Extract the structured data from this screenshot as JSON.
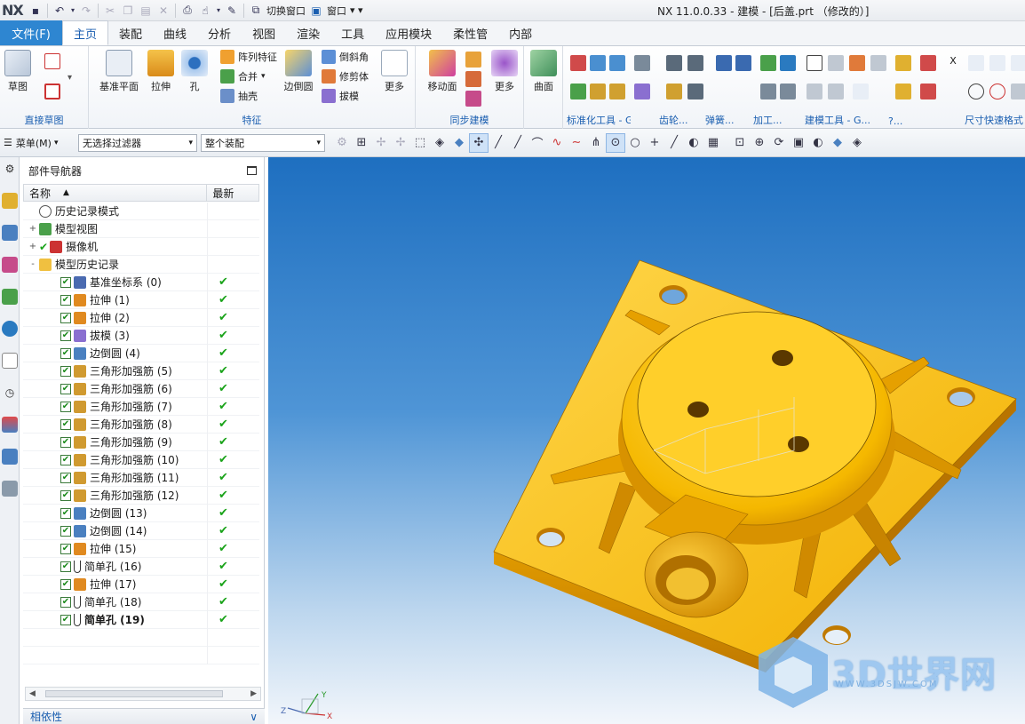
{
  "app": {
    "logo": "NX",
    "title": "NX 11.0.0.33 - 建模 - [后盖.prt （修改的）]"
  },
  "quick_access": {
    "switch_window": "切换窗口",
    "window": "窗口"
  },
  "tabs": [
    "文件(F)",
    "主页",
    "装配",
    "曲线",
    "分析",
    "视图",
    "渲染",
    "工具",
    "应用模块",
    "柔性管",
    "内部"
  ],
  "active_tab": "主页",
  "ribbon": {
    "direct_sketch": {
      "sketch": "草图",
      "label": "直接草图"
    },
    "feature": {
      "datum_plane": "基准平面",
      "extrude": "拉伸",
      "hole": "孔",
      "pattern": "阵列特征",
      "unite": "合并",
      "shell": "抽壳",
      "edge_blend": "边倒圆",
      "chamfer": "倒斜角",
      "trim_body": "修剪体",
      "draft": "拔模",
      "more": "更多",
      "label": "特征"
    },
    "sync": {
      "move_face": "移动面",
      "more": "更多",
      "label": "同步建模"
    },
    "surface": {
      "surface": "曲面"
    },
    "tools": {
      "std_tools": "标准化工具 - G...",
      "gear": "齿轮...",
      "spring": "弹簧...",
      "machining": "加工...",
      "modeling_tools": "建模工具 - G...",
      "more": "?...",
      "dim_quick": "尺寸快速格式"
    }
  },
  "cmdbar": {
    "menu": "菜单(M)",
    "filter": "无选择过滤器",
    "scope": "整个装配"
  },
  "navigator": {
    "title": "部件导航器",
    "col_name": "名称",
    "col_latest": "最新",
    "top_nodes": [
      {
        "label": "历史记录模式",
        "exp": ""
      },
      {
        "label": "模型视图",
        "exp": "+"
      },
      {
        "label": "摄像机",
        "exp": "+"
      },
      {
        "label": "模型历史记录",
        "exp": "-"
      }
    ],
    "features": [
      {
        "label": "基准坐标系 (0)",
        "icon": "csys"
      },
      {
        "label": "拉伸 (1)",
        "icon": "extrude"
      },
      {
        "label": "拉伸 (2)",
        "icon": "extrude"
      },
      {
        "label": "拔模 (3)",
        "icon": "draft"
      },
      {
        "label": "边倒圆 (4)",
        "icon": "blend"
      },
      {
        "label": "三角形加强筋 (5)",
        "icon": "rib"
      },
      {
        "label": "三角形加强筋 (6)",
        "icon": "rib"
      },
      {
        "label": "三角形加强筋 (7)",
        "icon": "rib"
      },
      {
        "label": "三角形加强筋 (8)",
        "icon": "rib"
      },
      {
        "label": "三角形加强筋 (9)",
        "icon": "rib"
      },
      {
        "label": "三角形加强筋 (10)",
        "icon": "rib"
      },
      {
        "label": "三角形加强筋 (11)",
        "icon": "rib"
      },
      {
        "label": "三角形加强筋 (12)",
        "icon": "rib"
      },
      {
        "label": "边倒圆 (13)",
        "icon": "blend"
      },
      {
        "label": "边倒圆 (14)",
        "icon": "blend"
      },
      {
        "label": "拉伸 (15)",
        "icon": "extrude"
      },
      {
        "label": "简单孔 (16)",
        "icon": "hole"
      },
      {
        "label": "拉伸 (17)",
        "icon": "extrude"
      },
      {
        "label": "简单孔 (18)",
        "icon": "hole"
      },
      {
        "label": "简单孔 (19)",
        "icon": "hole"
      }
    ],
    "dependency": "相依性"
  },
  "viewport": {
    "triad": {
      "x": "X",
      "y": "Y",
      "z": "Z"
    }
  },
  "watermark": {
    "text": "3D世界网",
    "sub": "WWW.3DSJW.COM"
  },
  "colors": {
    "file_tab": "#2e86d1",
    "part": "#f5b800",
    "check": "#1aa31a"
  }
}
